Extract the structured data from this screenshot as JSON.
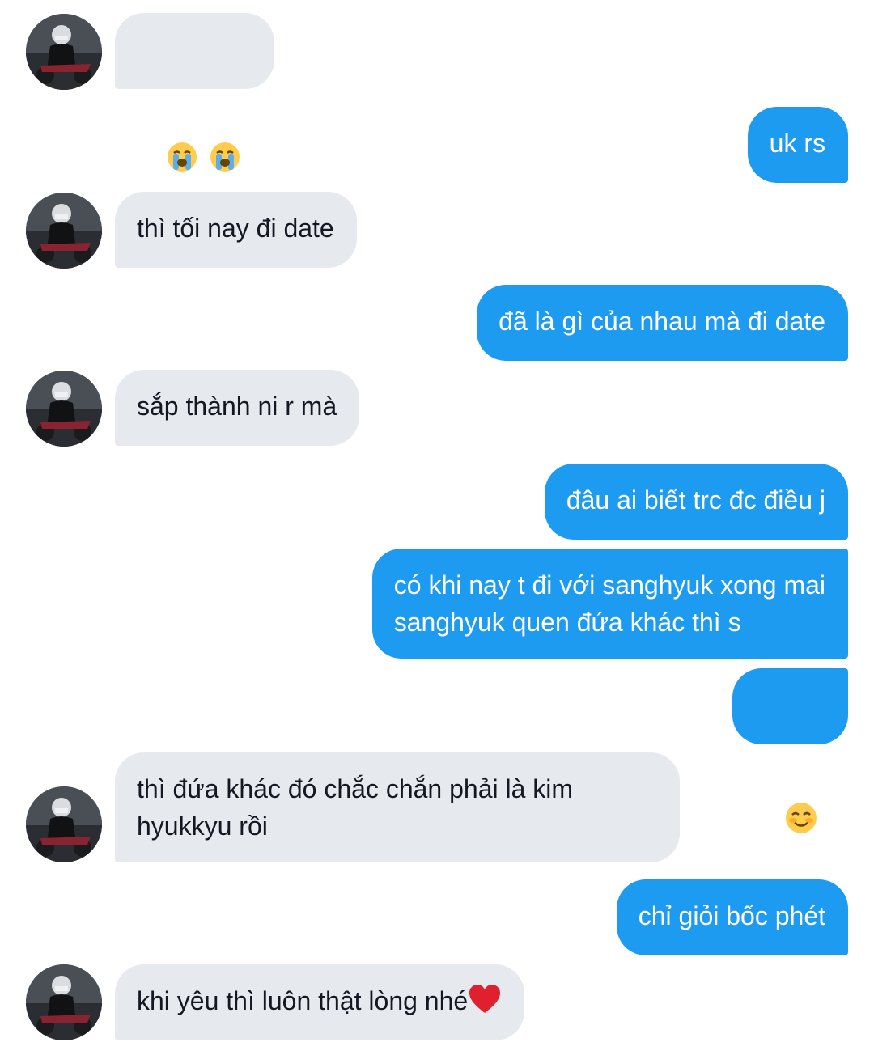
{
  "conversation": {
    "messages": [
      {
        "sender": "other",
        "emoji": "loudly-crying-face-icon",
        "emoji_count": 2
      },
      {
        "sender": "me",
        "text": "uk rs"
      },
      {
        "sender": "other",
        "text": "thì tối nay đi date"
      },
      {
        "sender": "me",
        "text": "đã là gì của nhau mà đi date"
      },
      {
        "sender": "other",
        "text": "sắp thành ni r mà"
      },
      {
        "sender": "me",
        "text": "đâu ai biết trc đc điều j"
      },
      {
        "sender": "me",
        "text": "có khi nay t đi với sanghyuk xong mai\nsanghyuk quen đứa khác thì s"
      },
      {
        "sender": "me",
        "emoji": "smiling-face-with-smiling-eyes-icon",
        "emoji_count": 1
      },
      {
        "sender": "other",
        "text": "thì đứa khác đó chắc chắn phải là kim\nhyukkyu rồi"
      },
      {
        "sender": "me",
        "text": "chỉ giỏi bốc phét"
      },
      {
        "sender": "other",
        "text": "khi yêu thì luôn thật lòng nhé",
        "trailing_emoji": "red-heart-icon"
      }
    ]
  },
  "colors": {
    "incoming_bubble": "#e6e9ed",
    "incoming_text": "#141823",
    "outgoing_bubble": "#1d9bf0",
    "outgoing_text": "#ffffff",
    "background": "#ffffff"
  }
}
